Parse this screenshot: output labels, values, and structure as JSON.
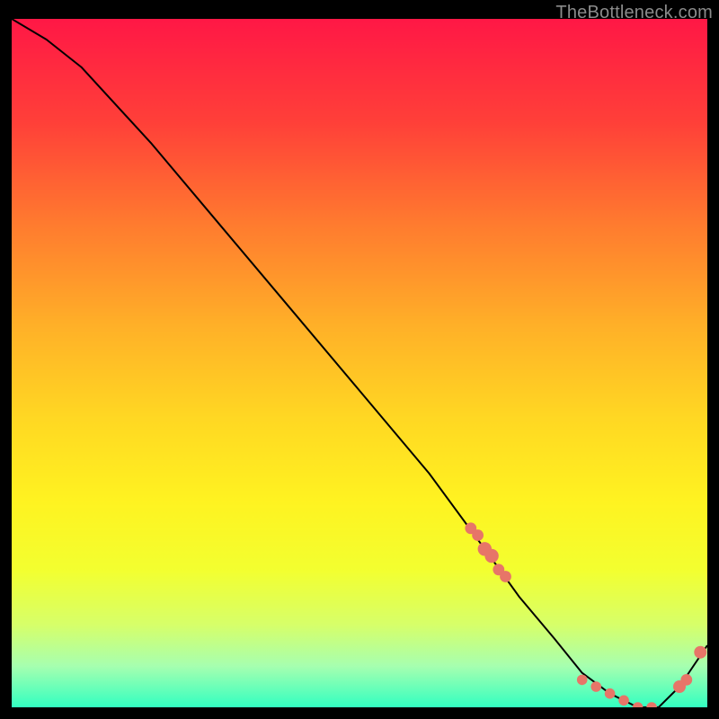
{
  "watermark": "TheBottleneck.com",
  "chart_data": {
    "type": "line",
    "title": "",
    "xlabel": "",
    "ylabel": "",
    "xlim": [
      0,
      100
    ],
    "ylim": [
      0,
      100
    ],
    "grid": false,
    "legend": false,
    "background_gradient": {
      "stops": [
        {
          "y_pct": 0,
          "color": "#ff1846"
        },
        {
          "y_pct": 15,
          "color": "#ff4039"
        },
        {
          "y_pct": 30,
          "color": "#ff7c2f"
        },
        {
          "y_pct": 45,
          "color": "#ffb228"
        },
        {
          "y_pct": 58,
          "color": "#ffd823"
        },
        {
          "y_pct": 70,
          "color": "#fff321"
        },
        {
          "y_pct": 80,
          "color": "#f3ff30"
        },
        {
          "y_pct": 88,
          "color": "#d7ff6a"
        },
        {
          "y_pct": 94,
          "color": "#a7ffb0"
        },
        {
          "y_pct": 100,
          "color": "#33ffc1"
        }
      ]
    },
    "series": [
      {
        "name": "bottleneck-curve",
        "color": "#000000",
        "x": [
          0,
          5,
          10,
          20,
          30,
          40,
          50,
          60,
          68,
          73,
          78,
          82,
          86,
          90,
          93,
          96,
          100
        ],
        "y": [
          100,
          97,
          93,
          82,
          70,
          58,
          46,
          34,
          23,
          16,
          10,
          5,
          2,
          0,
          0,
          3,
          9
        ]
      }
    ],
    "markers": [
      {
        "name": "cluster-descent-1",
        "x": 66,
        "y": 26,
        "color": "#e77568",
        "r": 2.0
      },
      {
        "name": "cluster-descent-2",
        "x": 67,
        "y": 25,
        "color": "#e77568",
        "r": 2.0
      },
      {
        "name": "cluster-descent-3",
        "x": 68,
        "y": 23,
        "color": "#e77568",
        "r": 2.4
      },
      {
        "name": "cluster-descent-4",
        "x": 69,
        "y": 22,
        "color": "#e77568",
        "r": 2.4
      },
      {
        "name": "cluster-descent-5",
        "x": 70,
        "y": 20,
        "color": "#e77568",
        "r": 2.0
      },
      {
        "name": "cluster-descent-6",
        "x": 71,
        "y": 19,
        "color": "#e77568",
        "r": 2.0
      },
      {
        "name": "valley-1",
        "x": 82,
        "y": 4,
        "color": "#e77568",
        "r": 1.8
      },
      {
        "name": "valley-2",
        "x": 84,
        "y": 3,
        "color": "#e77568",
        "r": 1.8
      },
      {
        "name": "valley-3",
        "x": 86,
        "y": 2,
        "color": "#e77568",
        "r": 1.8
      },
      {
        "name": "valley-4",
        "x": 88,
        "y": 1,
        "color": "#e77568",
        "r": 1.8
      },
      {
        "name": "valley-5",
        "x": 90,
        "y": 0,
        "color": "#e77568",
        "r": 1.8
      },
      {
        "name": "valley-6",
        "x": 92,
        "y": 0,
        "color": "#e77568",
        "r": 1.8
      },
      {
        "name": "cluster-ascent-1",
        "x": 96,
        "y": 3,
        "color": "#e77568",
        "r": 2.2
      },
      {
        "name": "cluster-ascent-2",
        "x": 97,
        "y": 4,
        "color": "#e77568",
        "r": 2.0
      },
      {
        "name": "cluster-ascent-3",
        "x": 99,
        "y": 8,
        "color": "#e77568",
        "r": 2.2
      }
    ]
  }
}
